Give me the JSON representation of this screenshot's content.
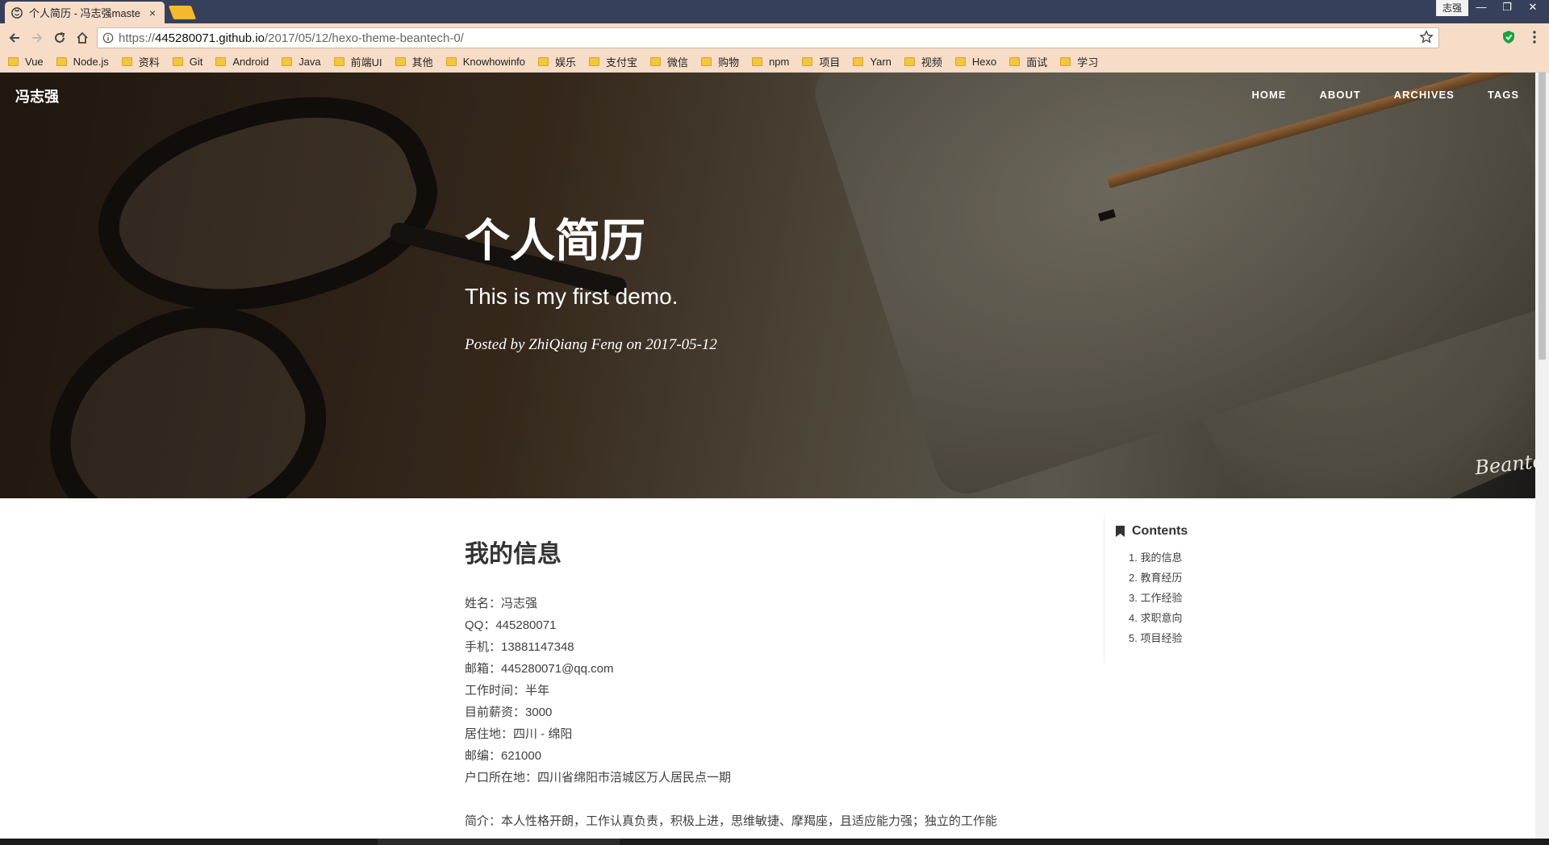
{
  "browser": {
    "tab_title": "个人简历 - 冯志强maste",
    "tab_close": "×",
    "profile_name": "志强",
    "window_controls": [
      "—",
      "❐",
      "✕"
    ],
    "url": {
      "scheme": "https://",
      "host": "445280071.github.io",
      "path": "/2017/05/12/hexo-theme-beantech-0/"
    },
    "icons": [
      "back-icon",
      "forward-icon",
      "reload-icon",
      "home-icon",
      "info-icon",
      "star-icon",
      "shield-extension-icon",
      "menu-icon"
    ]
  },
  "bookmarks": [
    "Vue",
    "Node.js",
    "资料",
    "Git",
    "Android",
    "Java",
    "前端UI",
    "其他",
    "Knowhowinfo",
    "娱乐",
    "支付宝",
    "微信",
    "购物",
    "npm",
    "项目",
    "Yarn",
    "视频",
    "Hexo",
    "面试",
    "学习"
  ],
  "site": {
    "brand": "冯志强",
    "nav": [
      "HOME",
      "ABOUT",
      "ARCHIVES",
      "TAGS"
    ],
    "signature": "Beantech."
  },
  "post": {
    "title": "个人简历",
    "subtitle": "This is my first demo.",
    "meta": "Posted by ZhiQiang Feng on 2017-05-12"
  },
  "article": {
    "heading": "我的信息",
    "info_lines": [
      "姓名：冯志强",
      "QQ：445280071",
      "手机：13881147348",
      "邮箱：445280071@qq.com",
      "工作时间：半年",
      "目前薪资：3000",
      "居住地：四川 - 绵阳",
      "邮编：621000",
      "户口所在地：四川省绵阳市涪城区万人居民点一期"
    ],
    "intro": "简介：本人性格开朗，工作认真负责，积极上进，思维敏捷、摩羯座，且适应能力强；独立的工作能"
  },
  "toc": {
    "title": "Contents",
    "items": [
      "1. 我的信息",
      "2. 教育经历",
      "3. 工作经验",
      "4. 求职意向",
      "5. 项目经验"
    ]
  }
}
